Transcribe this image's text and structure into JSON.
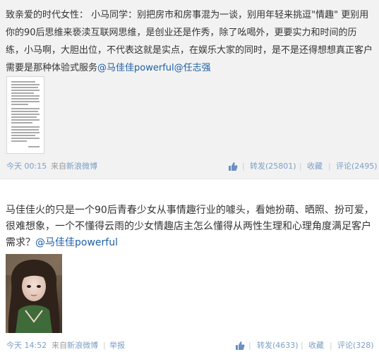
{
  "posts": [
    {
      "text_lead": "致亲爱的时代女性： 小马同学：别把房市和房事混为一谈，别用年轻来挑逗\"情趣\" 更别用你的90后思维来亵渎互联网思维，是创业还是作秀，除了吆喝外，更要实力和时间的历练，小马啊，大胆出位，不代表这就是实点，在娱乐大家的同时，是不是还得想想真正客户需要是那种体验式服务",
      "mention_1": "@马佳佳powerful",
      "mention_2": "@任志强",
      "time": "今天 00:15",
      "from_label": "来自",
      "source": "新浪微博",
      "repost": "转发(25801)",
      "favorite": "收藏",
      "comment": "评论(2495)",
      "separator": "|"
    },
    {
      "text_lead": "马佳佳火的只是一个90后青春少女从事情趣行业的噱头，看她扮萌、晒照、扮可爱，很难想象，一个不懂得云雨的少女情趣店主怎么懂得从两性生理和心理角度满足客户需求？",
      "mention_1": "@马佳佳powerful",
      "time": "今天 14:52",
      "from_label": "来自",
      "source": "新浪微博",
      "report": "举报",
      "repost": "转发(4633)",
      "favorite": "收藏",
      "comment": "评论(328)",
      "separator": "|"
    }
  ],
  "icons": {
    "like": "thumbs-up-icon"
  },
  "colors": {
    "link": "#1d5fa5",
    "meta_link": "#7b9fc6",
    "text": "#333333",
    "post1_bg": "#f2f2f2",
    "like_icon": "#6b8fc4"
  }
}
